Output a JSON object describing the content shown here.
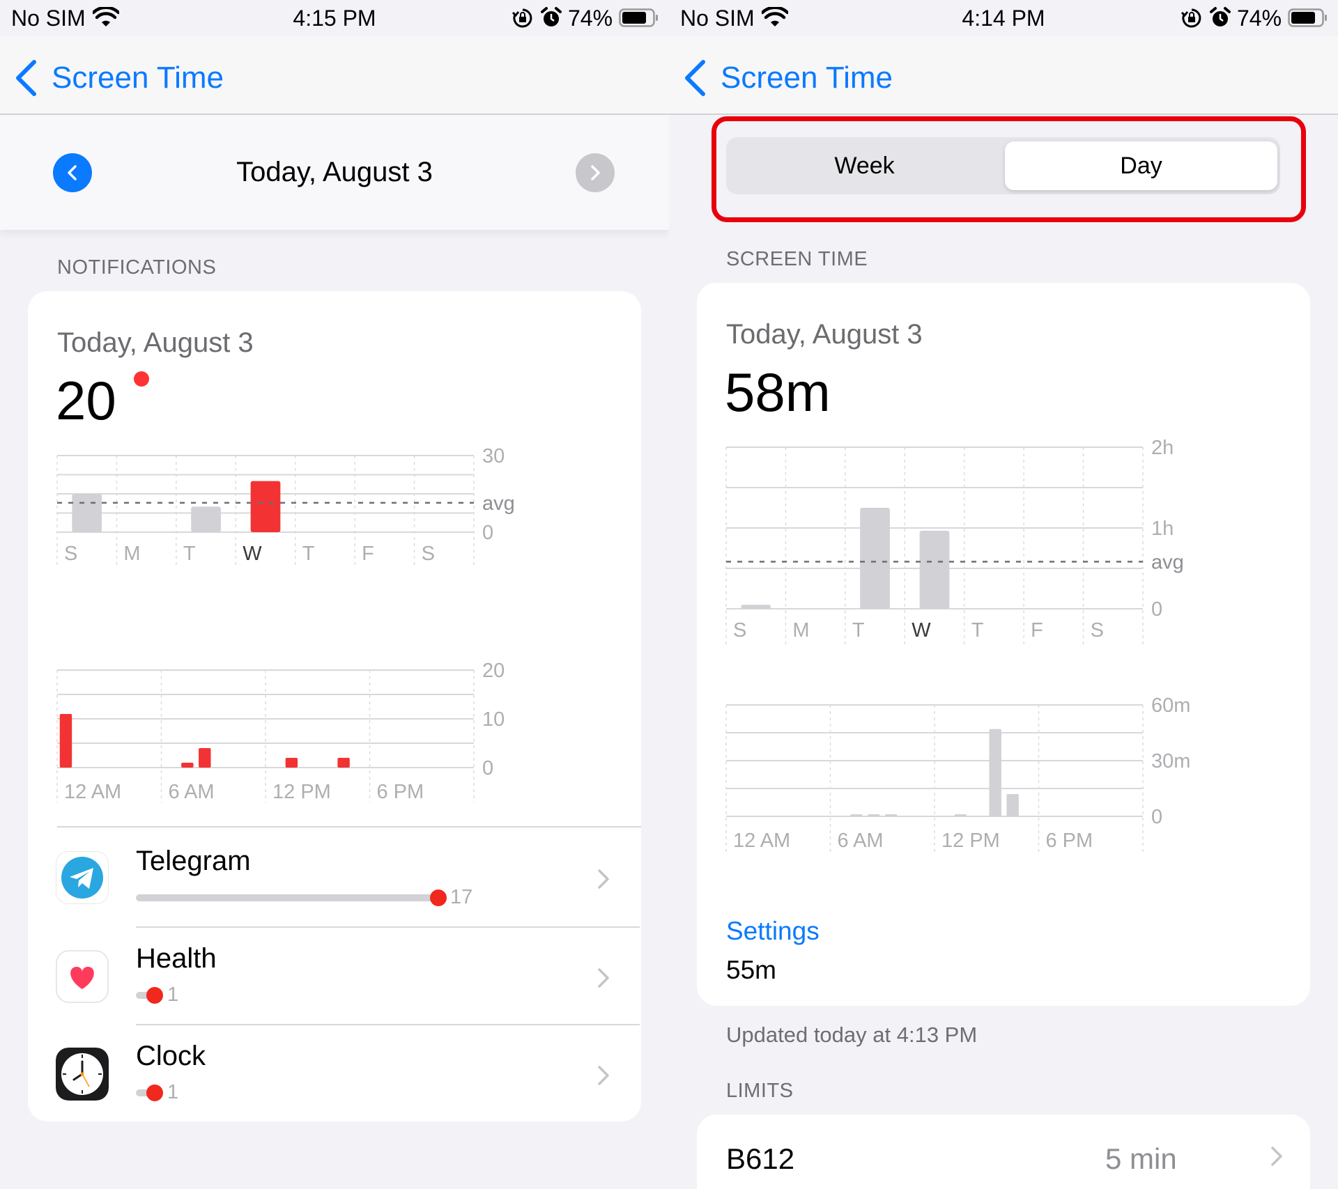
{
  "left_screen": {
    "status_bar": {
      "carrier": "No SIM",
      "time": "4:15 PM",
      "battery": "74%"
    },
    "nav": {
      "back_label": "Screen Time"
    },
    "date_header": {
      "title": "Today, August 3"
    },
    "section_label": "NOTIFICATIONS",
    "card": {
      "date": "Today, August 3",
      "count": "20",
      "week_chart_labels": {
        "max": "30",
        "avg": "avg",
        "zero": "0"
      },
      "day_chart_labels": {
        "max": "20",
        "mid": "10",
        "zero": "0"
      }
    },
    "apps": [
      {
        "name": "Telegram",
        "count": "17"
      },
      {
        "name": "Health",
        "count": "1"
      },
      {
        "name": "Clock",
        "count": "1"
      }
    ]
  },
  "right_screen": {
    "status_bar": {
      "carrier": "No SIM",
      "time": "4:14 PM",
      "battery": "74%"
    },
    "nav": {
      "back_label": "Screen Time"
    },
    "segmented_control": {
      "week_label": "Week",
      "day_label": "Day",
      "selected": "Day"
    },
    "section_label": "SCREEN TIME",
    "card": {
      "date": "Today, August 3",
      "total": "58m",
      "week_chart_labels": {
        "max": "2h",
        "mid": "1h",
        "avg": "avg",
        "zero": "0"
      },
      "day_chart_labels": {
        "max": "60m",
        "mid": "30m",
        "zero": "0"
      },
      "category_link": "Settings",
      "category_value": "55m"
    },
    "updated_text": "Updated today at 4:13 PM",
    "limits_label": "LIMITS",
    "limits": [
      {
        "name": "B612",
        "value": "5 min"
      }
    ]
  },
  "colors": {
    "accent_blue": "#0A7AFF",
    "notification_red": "#F33333",
    "bar_gray": "#D1D1D6",
    "highlight_red": "#E8000B",
    "background": "#F2F2F7"
  },
  "icons": {
    "status": [
      "wifi-icon",
      "orientation-lock-icon",
      "alarm-icon",
      "battery-icon"
    ],
    "nav": [
      "back-chevron-icon"
    ],
    "date": [
      "prev-day-icon",
      "next-day-icon"
    ],
    "apps": [
      "telegram-icon",
      "health-heart-icon",
      "clock-icon"
    ],
    "rows": [
      "chevron-right-icon"
    ]
  },
  "chart_data": [
    {
      "type": "bar",
      "title": "",
      "categories": [
        "S",
        "M",
        "T",
        "W",
        "T",
        "F",
        "S"
      ],
      "values": [
        15,
        0,
        10,
        20,
        null,
        null,
        null
      ],
      "avg": 11.5,
      "ylim": [
        0,
        30
      ],
      "yticks": [
        "30",
        "avg",
        "0"
      ],
      "highlight_index": 3,
      "colors": [
        "#D1D1D6",
        "#D1D1D6",
        "#D1D1D6",
        "#F33333"
      ]
    },
    {
      "type": "bar",
      "title": "",
      "categories": [
        "12 AM",
        "6 AM",
        "12 PM",
        "6 PM"
      ],
      "x_hours": [
        0,
        7,
        8,
        13,
        16
      ],
      "values": [
        11,
        1,
        4,
        2,
        2
      ],
      "ylim": [
        0,
        20
      ],
      "yticks": [
        "20",
        "10",
        "0"
      ],
      "color": "#F33333"
    },
    {
      "type": "bar",
      "title": "",
      "categories": [
        "S",
        "M",
        "T",
        "W",
        "T",
        "F",
        "S"
      ],
      "values_minutes": [
        3,
        0,
        75,
        58,
        null,
        null,
        null
      ],
      "avg_minutes": 35,
      "ylim": [
        0,
        120
      ],
      "yticks": [
        "2h",
        "1h",
        "avg",
        "0"
      ],
      "color": "#D1D1D6"
    },
    {
      "type": "bar",
      "title": "",
      "categories": [
        "12 AM",
        "6 AM",
        "12 PM",
        "6 PM"
      ],
      "x_hours": [
        7,
        8,
        9,
        13,
        15,
        16
      ],
      "values_minutes": [
        0.5,
        1,
        0.5,
        0.5,
        47,
        12
      ],
      "ylim": [
        0,
        60
      ],
      "yticks": [
        "60m",
        "30m",
        "0"
      ],
      "color": "#D1D1D6"
    }
  ]
}
